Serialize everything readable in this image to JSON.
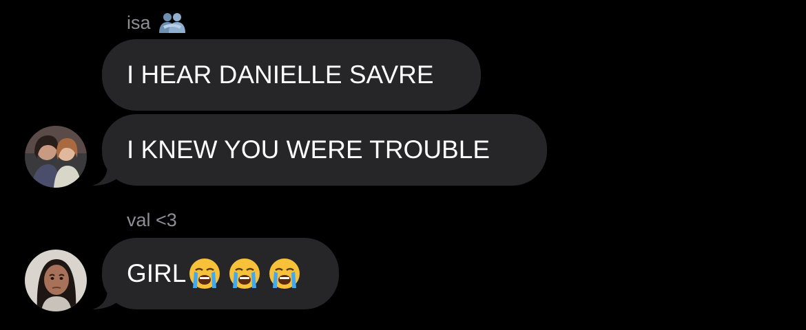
{
  "conversation": {
    "groups": [
      {
        "sender": "isa",
        "sender_icon": "people-hug-icon",
        "messages": [
          "I HEAR DANIELLE SAVRE",
          "I KNEW YOU WERE TROUBLE"
        ]
      },
      {
        "sender": "val <3",
        "messages": [
          "GIRL"
        ],
        "message_emojis": [
          "loudly-crying-face-icon",
          "loudly-crying-face-icon",
          "loudly-crying-face-icon"
        ]
      }
    ]
  },
  "colors": {
    "background": "#000000",
    "bubble": "#262628",
    "sender_name": "#8e8e93",
    "text": "#ffffff"
  }
}
